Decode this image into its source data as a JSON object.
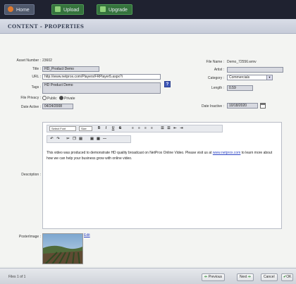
{
  "toolbar": {
    "home_label": "Home",
    "upload_label": "Upload",
    "upgrade_label": "Upgrade"
  },
  "section": {
    "title": "CONTENT - PROPERTIES"
  },
  "form": {
    "asset_number_label": "Asset Number :",
    "asset_number_value": "23602",
    "title_label": "Title :",
    "title_value": "HD_Product Demo",
    "url_label": "URL :",
    "url_value": "http://www.netprox.com/Players/FRPlayer5.aspx?i",
    "tags_label": "Tags :",
    "tags_value": "HD Product Demo",
    "file_privacy_label": "File Privacy :",
    "privacy_public": "Public",
    "privacy_private": "Private",
    "date_active_label": "Date Active :",
    "date_active_value": "04/24/2008",
    "file_name_label": "File Name :",
    "file_name_value": "Demo_72556.wmv",
    "artist_label": "Artist :",
    "artist_value": "",
    "category_label": "Category :",
    "category_value": "Commercials",
    "length_label": "Length :",
    "length_value": "0.59",
    "date_inactive_label": "Date Inactive :",
    "date_inactive_value": "10/18/2020",
    "help_icon": "?",
    "description_label": "Description :",
    "poster_label": "PosterImage :",
    "edit_link": "Edit"
  },
  "editor": {
    "font_select": "Select Font",
    "size_select": "Size",
    "buttons": [
      "B",
      "I",
      "U",
      "S"
    ],
    "content_before": "This video was produced to demonstrate HD quality broadcast on NetProx Online Video. Please visit us at ",
    "content_link": "www.netprox.com",
    "content_after": " to learn more about how we can help your business grow with online video."
  },
  "footer": {
    "files_status": "Files 1 of 1",
    "previous_label": "Previous",
    "next_label": "Next",
    "cancel_label": "Cancel",
    "ok_label": "OK"
  },
  "colors": {
    "topbar": "#1f2230",
    "accent_link": "#2c44c4",
    "help_button": "#3d57b8"
  }
}
